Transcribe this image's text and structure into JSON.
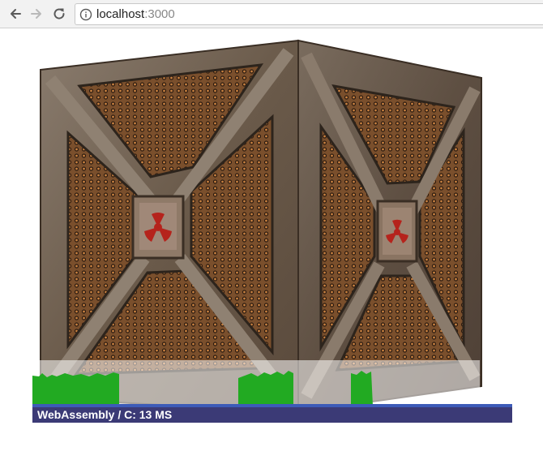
{
  "browser": {
    "url_host": "localhost",
    "url_port": ":3000"
  },
  "perf": {
    "label": "WebAssembly / C: 13 MS",
    "bar_color": "#3b3a76",
    "graph_color": "#22aa22"
  },
  "colors": {
    "crate_frame": "#6b5a4a",
    "crate_mesh": "#8a5a32",
    "hazard_red": "#b5231c"
  }
}
